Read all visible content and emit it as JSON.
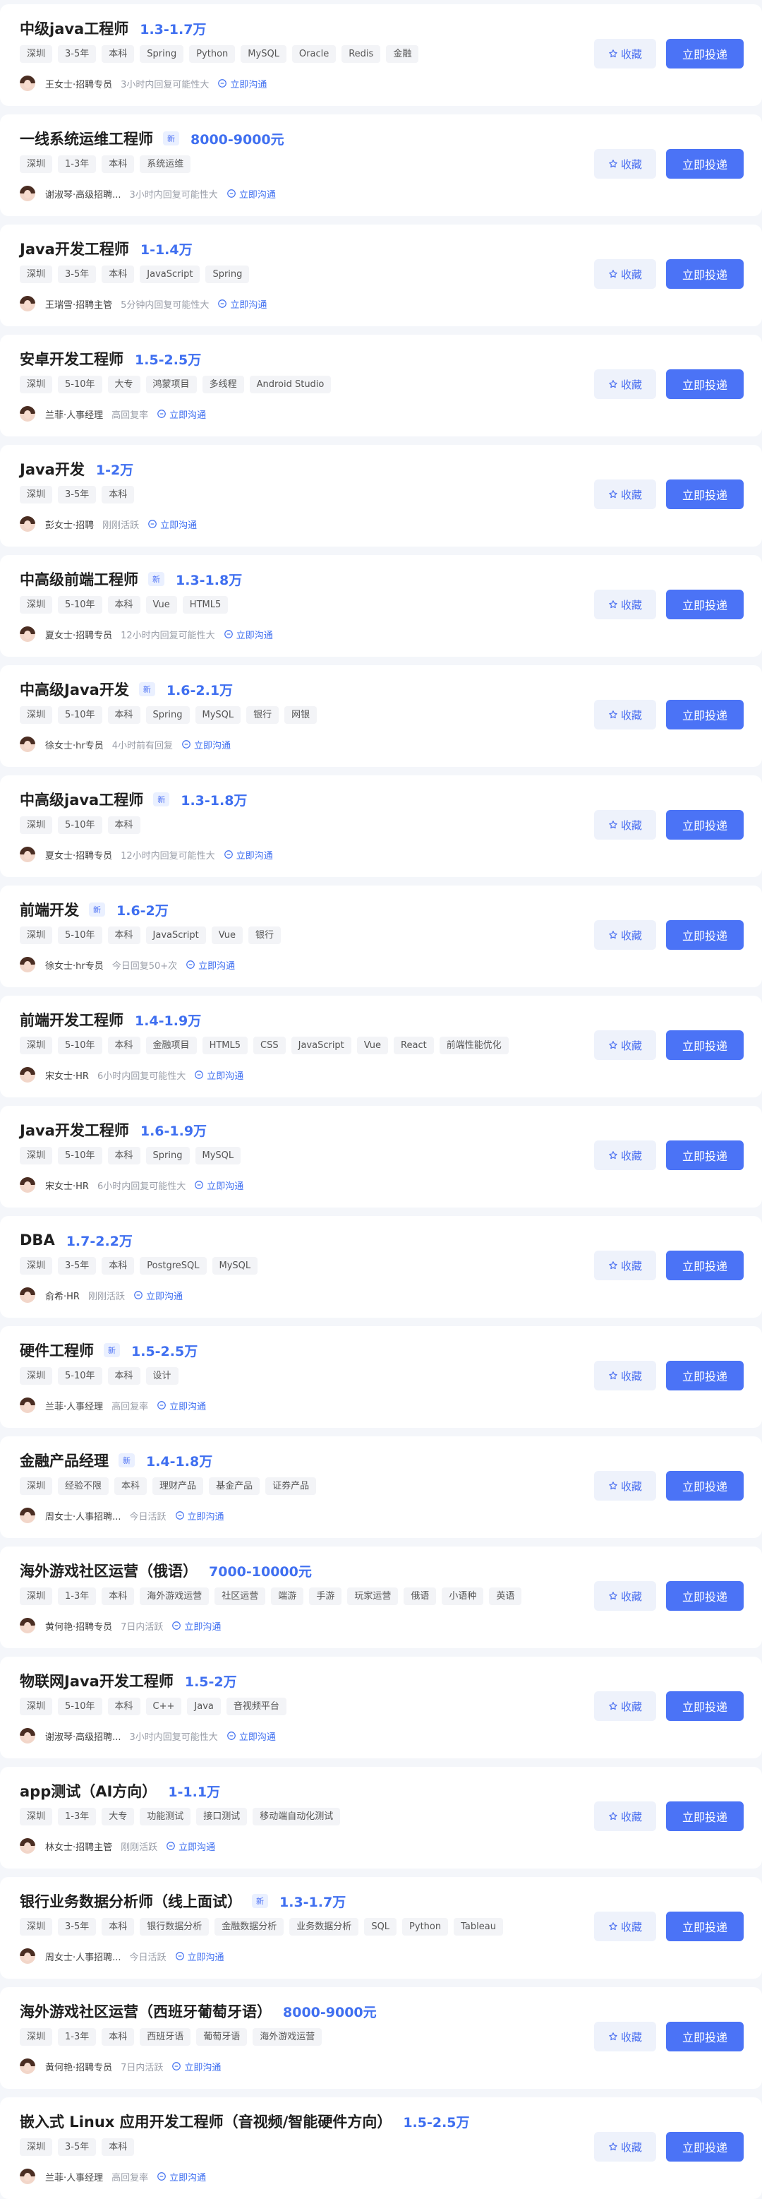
{
  "ui": {
    "collect_label": "收藏",
    "apply_label": "立即投递",
    "chat_label": "立即沟通",
    "new_badge": "新",
    "accent_color": "#4b73f6",
    "salary_color": "#3f6ff0"
  },
  "jobs": [
    {
      "title": "中级java工程师",
      "is_new": false,
      "salary": "1.3-1.7万",
      "tags": [
        "深圳",
        "3-5年",
        "本科",
        "Spring",
        "Python",
        "MySQL",
        "Oracle",
        "Redis",
        "金融"
      ],
      "recruiter": "王女士·招聘专员",
      "reply_status": "3小时内回复可能性大"
    },
    {
      "title": "一线系统运维工程师",
      "is_new": true,
      "salary": "8000-9000元",
      "tags": [
        "深圳",
        "1-3年",
        "本科",
        "系统运维"
      ],
      "recruiter": "谢淑琴·高级招聘...",
      "reply_status": "3小时内回复可能性大"
    },
    {
      "title": "Java开发工程师",
      "is_new": false,
      "salary": "1-1.4万",
      "tags": [
        "深圳",
        "3-5年",
        "本科",
        "JavaScript",
        "Spring"
      ],
      "recruiter": "王瑞雪·招聘主管",
      "reply_status": "5分钟内回复可能性大"
    },
    {
      "title": "安卓开发工程师",
      "is_new": false,
      "salary": "1.5-2.5万",
      "tags": [
        "深圳",
        "5-10年",
        "大专",
        "鸿蒙项目",
        "多线程",
        "Android Studio"
      ],
      "recruiter": "兰菲·人事经理",
      "reply_status": "高回复率"
    },
    {
      "title": "Java开发",
      "is_new": false,
      "salary": "1-2万",
      "tags": [
        "深圳",
        "3-5年",
        "本科"
      ],
      "recruiter": "彭女士·招聘",
      "reply_status": "刚刚活跃"
    },
    {
      "title": "中高级前端工程师",
      "is_new": true,
      "salary": "1.3-1.8万",
      "tags": [
        "深圳",
        "5-10年",
        "本科",
        "Vue",
        "HTML5"
      ],
      "recruiter": "夏女士·招聘专员",
      "reply_status": "12小时内回复可能性大"
    },
    {
      "title": "中高级Java开发",
      "is_new": true,
      "salary": "1.6-2.1万",
      "tags": [
        "深圳",
        "5-10年",
        "本科",
        "Spring",
        "MySQL",
        "银行",
        "网银"
      ],
      "recruiter": "徐女士·hr专员",
      "reply_status": "4小时前有回复"
    },
    {
      "title": "中高级java工程师",
      "is_new": true,
      "salary": "1.3-1.8万",
      "tags": [
        "深圳",
        "5-10年",
        "本科"
      ],
      "recruiter": "夏女士·招聘专员",
      "reply_status": "12小时内回复可能性大"
    },
    {
      "title": "前端开发",
      "is_new": true,
      "salary": "1.6-2万",
      "tags": [
        "深圳",
        "5-10年",
        "本科",
        "JavaScript",
        "Vue",
        "银行"
      ],
      "recruiter": "徐女士·hr专员",
      "reply_status": "今日回复50+次"
    },
    {
      "title": "前端开发工程师",
      "is_new": false,
      "salary": "1.4-1.9万",
      "tags": [
        "深圳",
        "5-10年",
        "本科",
        "金融项目",
        "HTML5",
        "CSS",
        "JavaScript",
        "Vue",
        "React",
        "前端性能优化"
      ],
      "recruiter": "宋女士·HR",
      "reply_status": "6小时内回复可能性大"
    },
    {
      "title": "Java开发工程师",
      "is_new": false,
      "salary": "1.6-1.9万",
      "tags": [
        "深圳",
        "5-10年",
        "本科",
        "Spring",
        "MySQL"
      ],
      "recruiter": "宋女士·HR",
      "reply_status": "6小时内回复可能性大"
    },
    {
      "title": "DBA",
      "is_new": false,
      "salary": "1.7-2.2万",
      "tags": [
        "深圳",
        "3-5年",
        "本科",
        "PostgreSQL",
        "MySQL"
      ],
      "recruiter": "俞希·HR",
      "reply_status": "刚刚活跃"
    },
    {
      "title": "硬件工程师",
      "is_new": true,
      "salary": "1.5-2.5万",
      "tags": [
        "深圳",
        "5-10年",
        "本科",
        "设计"
      ],
      "recruiter": "兰菲·人事经理",
      "reply_status": "高回复率"
    },
    {
      "title": "金融产品经理",
      "is_new": true,
      "salary": "1.4-1.8万",
      "tags": [
        "深圳",
        "经验不限",
        "本科",
        "理财产品",
        "基金产品",
        "证券产品"
      ],
      "recruiter": "周女士·人事招聘...",
      "reply_status": "今日活跃"
    },
    {
      "title": "海外游戏社区运营（俄语）",
      "is_new": false,
      "salary": "7000-10000元",
      "tags": [
        "深圳",
        "1-3年",
        "本科",
        "海外游戏运营",
        "社区运营",
        "端游",
        "手游",
        "玩家运营",
        "俄语",
        "小语种",
        "英语"
      ],
      "recruiter": "黄何艳·招聘专员",
      "reply_status": "7日内活跃"
    },
    {
      "title": "物联网Java开发工程师",
      "is_new": false,
      "salary": "1.5-2万",
      "tags": [
        "深圳",
        "5-10年",
        "本科",
        "C++",
        "Java",
        "音视频平台"
      ],
      "recruiter": "谢淑琴·高级招聘...",
      "reply_status": "3小时内回复可能性大"
    },
    {
      "title": "app测试（AI方向）",
      "is_new": false,
      "salary": "1-1.1万",
      "tags": [
        "深圳",
        "1-3年",
        "大专",
        "功能测试",
        "接口测试",
        "移动端自动化测试"
      ],
      "recruiter": "林女士·招聘主管",
      "reply_status": "刚刚活跃"
    },
    {
      "title": "银行业务数据分析师（线上面试）",
      "is_new": true,
      "salary": "1.3-1.7万",
      "tags": [
        "深圳",
        "3-5年",
        "本科",
        "银行数据分析",
        "金融数据分析",
        "业务数据分析",
        "SQL",
        "Python",
        "Tableau"
      ],
      "recruiter": "周女士·人事招聘...",
      "reply_status": "今日活跃"
    },
    {
      "title": "海外游戏社区运营（西班牙葡萄牙语）",
      "is_new": false,
      "salary": "8000-9000元",
      "tags": [
        "深圳",
        "1-3年",
        "本科",
        "西班牙语",
        "葡萄牙语",
        "海外游戏运营"
      ],
      "recruiter": "黄何艳·招聘专员",
      "reply_status": "7日内活跃"
    },
    {
      "title": "嵌入式 Linux 应用开发工程师（音视频/智能硬件方向）",
      "is_new": false,
      "salary": "1.5-2.5万",
      "tags": [
        "深圳",
        "3-5年",
        "本科"
      ],
      "recruiter": "兰菲·人事经理",
      "reply_status": "高回复率"
    }
  ]
}
